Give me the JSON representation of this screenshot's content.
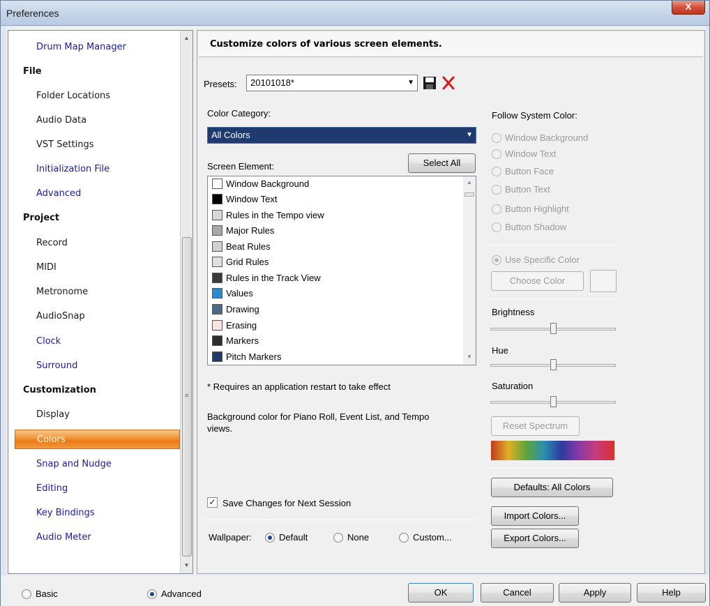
{
  "window": {
    "title": "Preferences",
    "close_label": "X"
  },
  "nav": {
    "items": [
      {
        "label": "Drum Map Manager",
        "kind": "link"
      },
      {
        "label": "File",
        "kind": "section"
      },
      {
        "label": "Folder Locations",
        "kind": "item"
      },
      {
        "label": "Audio Data",
        "kind": "item"
      },
      {
        "label": "VST Settings",
        "kind": "item"
      },
      {
        "label": "Initialization File",
        "kind": "link"
      },
      {
        "label": "Advanced",
        "kind": "link"
      },
      {
        "label": "Project",
        "kind": "section"
      },
      {
        "label": "Record",
        "kind": "item"
      },
      {
        "label": "MIDI",
        "kind": "item"
      },
      {
        "label": "Metronome",
        "kind": "item"
      },
      {
        "label": "AudioSnap",
        "kind": "item"
      },
      {
        "label": "Clock",
        "kind": "link"
      },
      {
        "label": "Surround",
        "kind": "link"
      },
      {
        "label": "Customization",
        "kind": "section"
      },
      {
        "label": "Display",
        "kind": "item"
      },
      {
        "label": "Colors",
        "kind": "selected"
      },
      {
        "label": "Snap and Nudge",
        "kind": "link"
      },
      {
        "label": "Editing",
        "kind": "link"
      },
      {
        "label": "Key Bindings",
        "kind": "link"
      },
      {
        "label": "Audio Meter",
        "kind": "link"
      }
    ]
  },
  "panel": {
    "header": "Customize colors of various screen elements.",
    "presets_label": "Presets:",
    "presets_value": "20101018*",
    "color_category_label": "Color Category:",
    "color_category_value": "All Colors",
    "select_all": "Select All",
    "screen_element_label": "Screen Element:",
    "elements": [
      {
        "label": "Window Background",
        "color": "#ffffff"
      },
      {
        "label": "Window Text",
        "color": "#000000"
      },
      {
        "label": "Rules in the Tempo view",
        "color": "#d8d8d8"
      },
      {
        "label": "Major Rules",
        "color": "#a8a8a8"
      },
      {
        "label": "Beat Rules",
        "color": "#d0d0d0"
      },
      {
        "label": "Grid Rules",
        "color": "#e0e0e0"
      },
      {
        "label": "Rules in the Track View",
        "color": "#3a3a3a"
      },
      {
        "label": "Values",
        "color": "#2a8ad0"
      },
      {
        "label": "Drawing",
        "color": "#4a6a8a"
      },
      {
        "label": "Erasing",
        "color": "#fde2e2"
      },
      {
        "label": "Markers",
        "color": "#2e2e2e"
      },
      {
        "label": "Pitch Markers",
        "color": "#1f3c6a"
      }
    ],
    "restart_note": "* Requires an application restart to take effect",
    "description_line1": "Background color for Piano Roll, Event List, and Tempo",
    "description_line2": "views.",
    "save_changes": "Save Changes for Next Session",
    "wallpaper_label": "Wallpaper:",
    "wallpaper_options": [
      "Default",
      "None",
      "Custom..."
    ],
    "follow_label": "Follow System Color:",
    "follow_options": [
      "Window Background",
      "Window Text",
      "Button Face",
      "Button Text",
      "Button Highlight",
      "Button Shadow"
    ],
    "use_specific": "Use Specific Color",
    "choose_color": "Choose Color",
    "brightness": "Brightness",
    "hue": "Hue",
    "saturation": "Saturation",
    "reset_spectrum": "Reset Spectrum",
    "defaults": "Defaults: All Colors",
    "import_colors": "Import Colors...",
    "export_colors": "Export Colors..."
  },
  "footer": {
    "basic": "Basic",
    "advanced": "Advanced",
    "ok": "OK",
    "cancel": "Cancel",
    "apply": "Apply",
    "help": "Help"
  }
}
